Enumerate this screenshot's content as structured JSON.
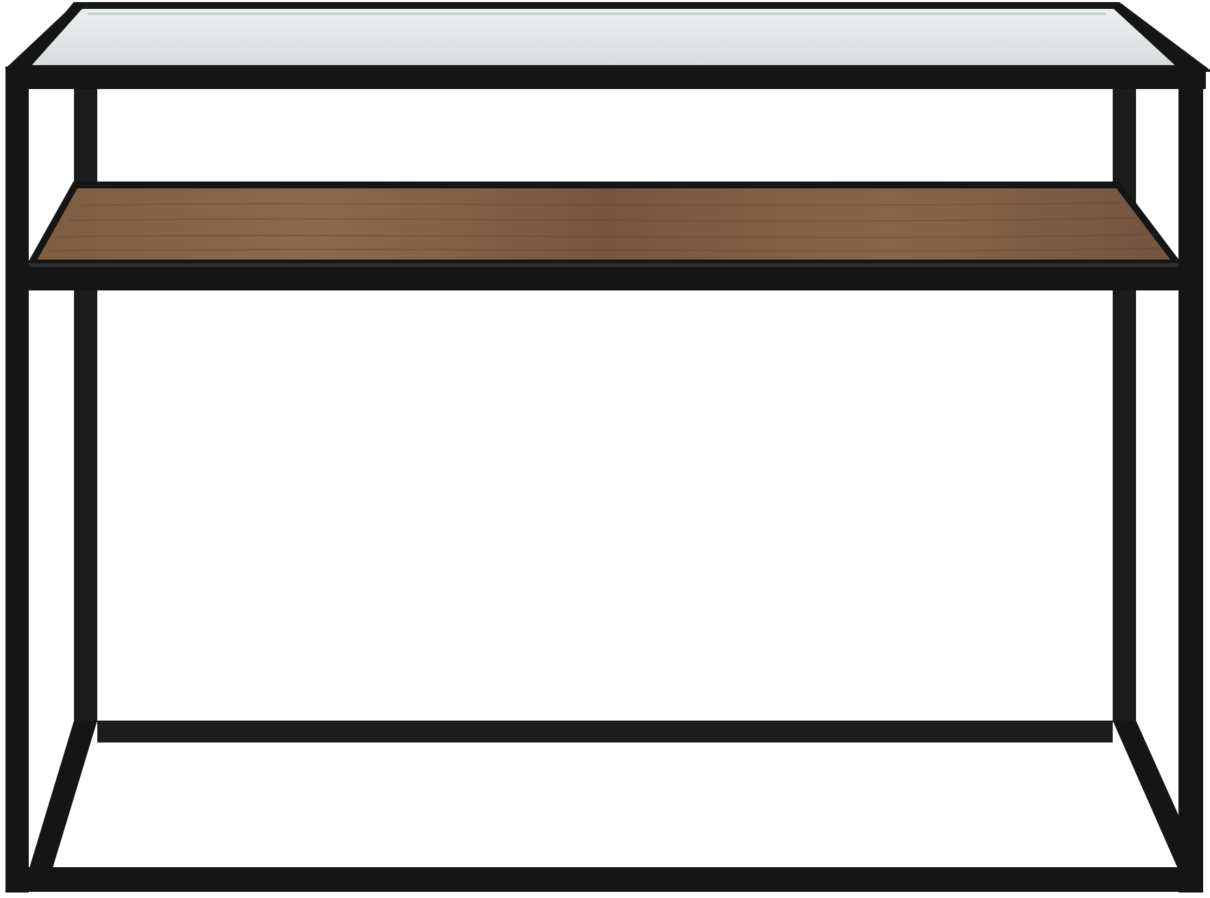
{
  "image": {
    "subject": "console-table",
    "background": "#ffffff"
  },
  "colors": {
    "frame": "#151515",
    "frame_highlight": "#2c2c2c",
    "glass": "#dfe3e3",
    "glass_edge": "#c3c9c9",
    "wood": "#7a5a40",
    "wood_light": "#8f6c4f",
    "wood_dark": "#5f4330"
  }
}
